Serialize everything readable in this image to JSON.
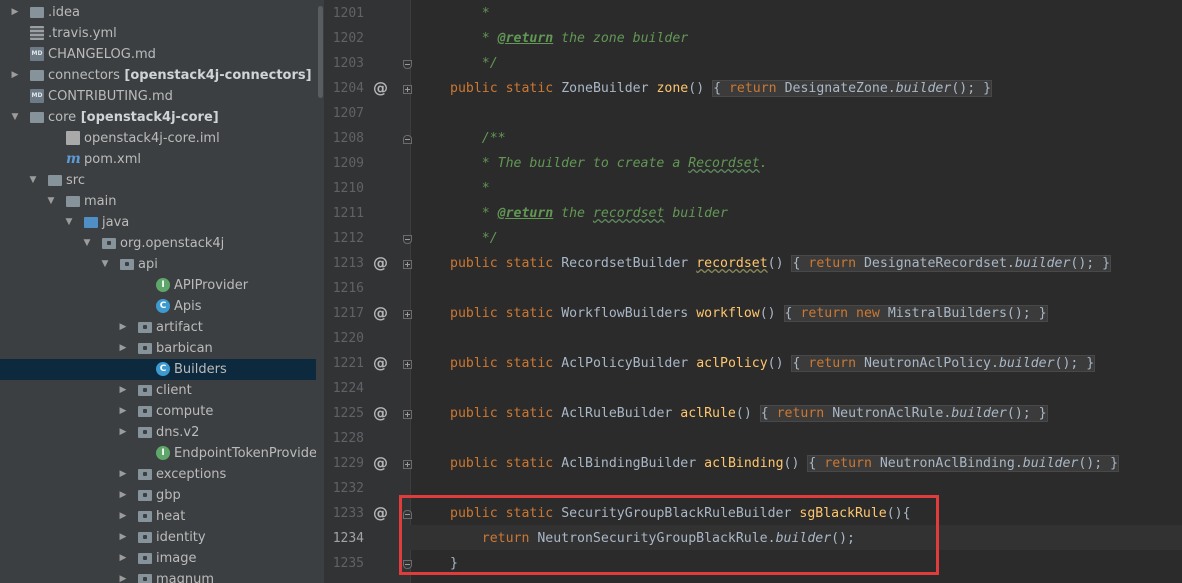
{
  "project_tree": {
    "items": [
      {
        "label": "idea",
        "prefix": ".",
        "icon": "folder-icon",
        "arrow": "right",
        "bold": ""
      },
      {
        "label": ".travis.yml",
        "icon": "yaml-file-icon",
        "arrow": "",
        "bold": ""
      },
      {
        "label": "CHANGELOG.md",
        "icon": "markdown-file-icon",
        "arrow": "",
        "bold": ""
      },
      {
        "label": "connectors",
        "icon": "folder-icon",
        "arrow": "right",
        "bold": "[openstack4j-connectors]"
      },
      {
        "label": "CONTRIBUTING.md",
        "icon": "markdown-file-icon",
        "arrow": "",
        "bold": ""
      },
      {
        "label": "core",
        "icon": "folder-icon",
        "arrow": "down",
        "bold": "[openstack4j-core]"
      },
      {
        "label": "openstack4j-core.iml",
        "icon": "iml-file-icon",
        "arrow": "",
        "bold": ""
      },
      {
        "label": "pom.xml",
        "icon": "maven-file-icon",
        "arrow": "",
        "bold": ""
      },
      {
        "label": "src",
        "icon": "folder-icon",
        "arrow": "down",
        "bold": ""
      },
      {
        "label": "main",
        "icon": "folder-icon",
        "arrow": "down",
        "bold": ""
      },
      {
        "label": "java",
        "icon": "source-folder-icon",
        "arrow": "down",
        "bold": ""
      },
      {
        "label": "org.openstack4j",
        "icon": "package-icon",
        "arrow": "down",
        "bold": ""
      },
      {
        "label": "api",
        "icon": "package-icon",
        "arrow": "down",
        "bold": ""
      },
      {
        "label": "APIProvider",
        "icon": "interface-icon",
        "arrow": "",
        "bold": ""
      },
      {
        "label": "Apis",
        "icon": "class-icon",
        "arrow": "",
        "bold": ""
      },
      {
        "label": "artifact",
        "icon": "package-icon",
        "arrow": "right",
        "bold": ""
      },
      {
        "label": "barbican",
        "icon": "package-icon",
        "arrow": "right",
        "bold": ""
      },
      {
        "label": "Builders",
        "icon": "class-icon",
        "arrow": "",
        "bold": "",
        "selected": true
      },
      {
        "label": "client",
        "icon": "package-icon",
        "arrow": "right",
        "bold": ""
      },
      {
        "label": "compute",
        "icon": "package-icon",
        "arrow": "right",
        "bold": ""
      },
      {
        "label": "dns.v2",
        "icon": "package-icon",
        "arrow": "right",
        "bold": ""
      },
      {
        "label": "EndpointTokenProvider",
        "icon": "interface-icon",
        "arrow": "",
        "bold": ""
      },
      {
        "label": "exceptions",
        "icon": "package-icon",
        "arrow": "right",
        "bold": ""
      },
      {
        "label": "gbp",
        "icon": "package-icon",
        "arrow": "right",
        "bold": ""
      },
      {
        "label": "heat",
        "icon": "package-icon",
        "arrow": "right",
        "bold": ""
      },
      {
        "label": "identity",
        "icon": "package-icon",
        "arrow": "right",
        "bold": ""
      },
      {
        "label": "image",
        "icon": "package-icon",
        "arrow": "right",
        "bold": ""
      },
      {
        "label": "magnum",
        "icon": "package-icon",
        "arrow": "right",
        "bold": ""
      }
    ]
  },
  "editor": {
    "line_numbers": [
      "1201",
      "1202",
      "1203",
      "1204",
      "1207",
      "1208",
      "1209",
      "1210",
      "1211",
      "1212",
      "1213",
      "1216",
      "1217",
      "1220",
      "1221",
      "1224",
      "1225",
      "1228",
      "1229",
      "1232",
      "1233",
      "1234",
      "1235"
    ],
    "current_line": "1234",
    "icon_labels": {
      "override": "@",
      "class_letter": "C",
      "interface_letter": "I",
      "md_badge": "MD"
    },
    "code": {
      "l1201": "*",
      "l1202_tag": "@return",
      "l1202_rest": " the zone builder",
      "l1203": "*/",
      "kw_public": "public",
      "kw_static": "static",
      "kw_return": "return",
      "kw_new": "new",
      "l1204_type": "ZoneBuilder",
      "l1204_fn": "zone",
      "l1204_target": "DesignateZone",
      "builder": "builder",
      "l1208": "/**",
      "l1209_a": "* The builder to create a ",
      "l1209_b": "Recordset",
      "l1209_c": ".",
      "l1210": "*",
      "l1211_tag": "@return",
      "l1211_a": " the ",
      "l1211_b": "recordset",
      "l1211_c": " builder",
      "l1212": "*/",
      "l1213_type": "RecordsetBuilder",
      "l1213_fn": "recordset",
      "l1213_target": "DesignateRecordset",
      "l1217_type": "WorkflowBuilders",
      "l1217_fn": "workflow",
      "l1217_target": "MistralBuilders",
      "l1221_type": "AclPolicyBuilder",
      "l1221_fn": "aclPolicy",
      "l1221_target": "NeutronAclPolicy",
      "l1225_type": "AclRuleBuilder",
      "l1225_fn": "aclRule",
      "l1225_target": "NeutronAclRule",
      "l1229_type": "AclBindingBuilder",
      "l1229_fn": "aclBinding",
      "l1229_target": "NeutronAclBinding",
      "l1233_type": "SecurityGroupBlackRuleBuilder",
      "l1233_fn": "sgBlackRule",
      "l1234_target": "NeutronSecurityGroupBlackRule",
      "brace_close": "}"
    }
  }
}
